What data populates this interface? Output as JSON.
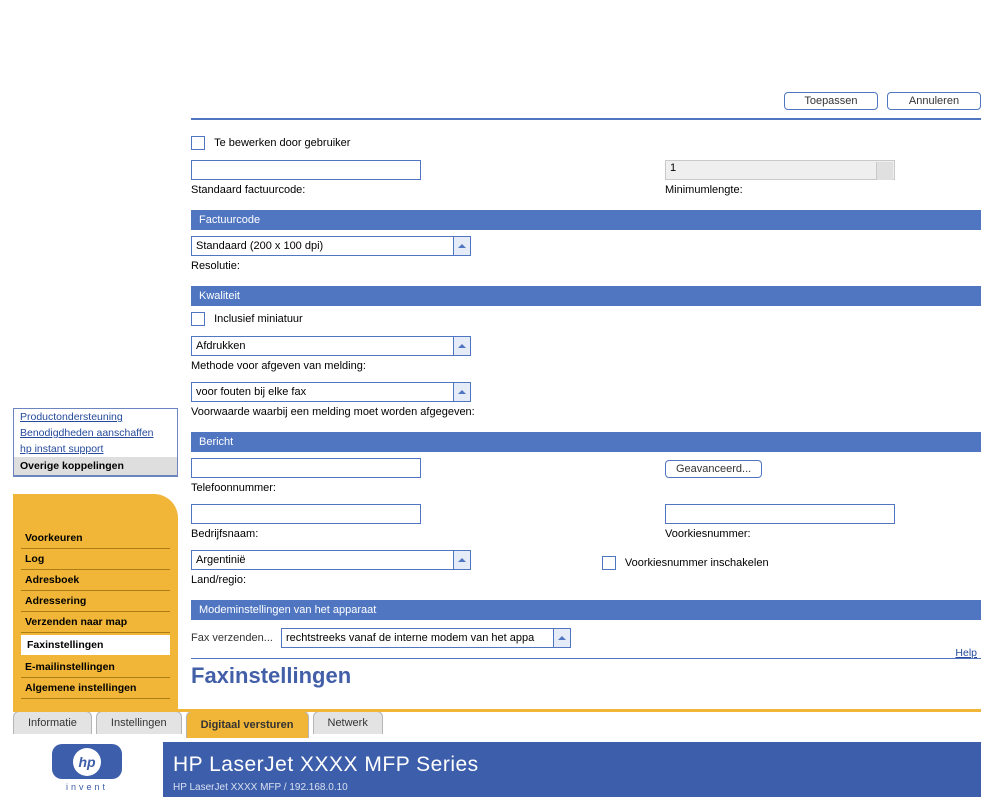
{
  "header": {
    "small": "HP LaserJet XXXX MFP / 192.168.0.10",
    "big": "HP LaserJet XXXX MFP Series",
    "logo_sub": "invent"
  },
  "tabs": {
    "items": [
      "Informatie",
      "Instellingen",
      "Digitaal versturen",
      "Netwerk"
    ],
    "active": 2
  },
  "sidebar": {
    "items": [
      "Algemene instellingen",
      "E-mailinstellingen",
      "Faxinstellingen",
      "Verzenden naar map",
      "Adressering",
      "Adresboek",
      "Log",
      "Voorkeuren"
    ],
    "selected": 2
  },
  "links": {
    "title": "Overige koppelingen",
    "items": [
      "hp instant support",
      "Benodigdheden aanschaffen",
      "Productondersteuning"
    ]
  },
  "page": {
    "title": "Faxinstellingen",
    "help": "Help"
  },
  "send_fax": {
    "label": "Fax verzenden...",
    "value": "rechtstreeks vanaf de interne modem van het appa"
  },
  "section_modem": "Modeminstellingen van het apparaat",
  "modem": {
    "country_label": "Land/regio:",
    "country_value": "Argentinië",
    "prefix_enable_label": "Voorkiesnummer inschakelen",
    "company_label": "Bedrijfsnaam:",
    "prefix_label": "Voorkiesnummer:",
    "phone_label": "Telefoonnummer:",
    "advanced_btn": "Geavanceerd..."
  },
  "section_msg": "Bericht",
  "msg": {
    "cond_label": "Voorwaarde waarbij een melding moet worden afgegeven:",
    "cond_value": "voor fouten bij elke fax",
    "method_label": "Methode voor afgeven van melding:",
    "method_value": "Afdrukken",
    "thumb_label": "Inclusief miniatuur"
  },
  "section_quality": "Kwaliteit",
  "quality": {
    "res_label": "Resolutie:",
    "res_value": "Standaard (200 x 100 dpi)"
  },
  "section_billing": "Factuurcode",
  "billing": {
    "std_label": "Standaard factuurcode:",
    "minlen_label": "Minimumlengte:",
    "minlen_value": "1",
    "editable_label": "Te bewerken door gebruiker"
  },
  "footer": {
    "apply": "Toepassen",
    "cancel": "Annuleren"
  }
}
